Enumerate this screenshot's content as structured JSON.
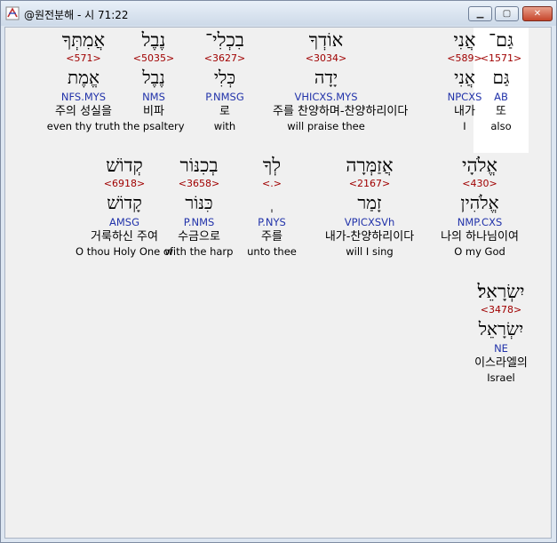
{
  "window": {
    "title": "@원전분해 - 시 71:22"
  },
  "controls": {
    "minimize": "▁",
    "maximize": "▢",
    "close": "✕"
  },
  "rows": [
    [
      {
        "heb": "גַּם־",
        "strong": "<1571>",
        "lemma": "גַּם",
        "morph": "AB",
        "kor": "또",
        "eng": "also",
        "selected": true
      },
      {
        "heb": "אֲנִי",
        "strong": "<589>",
        "lemma": "אֲנִי",
        "morph": "NPCXS",
        "kor": "내가",
        "eng": "I"
      },
      {
        "heb": "אוֹדְךָ",
        "strong": "<3034>",
        "lemma": "יָדָה",
        "morph": "VHICXS.MYS",
        "kor": "주를 찬양하며-찬양하리이다",
        "eng": "will praise thee"
      },
      {
        "heb": "בִכְלִי־",
        "strong": "<3627>",
        "lemma": "כְּלִי",
        "morph": "P.NMSG",
        "kor": "로",
        "eng": "with"
      },
      {
        "heb": "נֶבֶל",
        "strong": "<5035>",
        "lemma": "נֶבֶל",
        "morph": "NMS",
        "kor": "비파",
        "eng": "the psaltery"
      },
      {
        "heb": "אֲמִתְּךָ",
        "strong": "<571>",
        "lemma": "אֱמֶת",
        "morph": "NFS.MYS",
        "kor": "주의 성실을",
        "eng": "even thy truth"
      }
    ],
    [
      {
        "heb": "אֱלֹהָי",
        "strong": "<430>",
        "lemma": "אֱלֹהִין",
        "morph": "NMP.CXS",
        "kor": "나의 하나님이여",
        "eng": "O my God"
      },
      {
        "heb": "אֲזַמְּרָה",
        "strong": "<2167>",
        "lemma": "זָמַר",
        "morph": "VPICXSVh",
        "kor": "내가-찬양하리이다",
        "eng": "will I sing"
      },
      {
        "heb": "לְךָ",
        "strong": "<.>",
        "lemma": "ְ",
        "morph": "P.NYS",
        "kor": "주를",
        "eng": "unto thee"
      },
      {
        "heb": "בְכִנּוֹר",
        "strong": "<3658>",
        "lemma": "כִּנּוֹר",
        "morph": "P.NMS",
        "kor": "수금으로",
        "eng": "with the harp"
      },
      {
        "heb": "קְדוֹשׁ",
        "strong": "<6918>",
        "lemma": "קָדוֹשׁ",
        "morph": "AMSG",
        "kor": "거룩하신 주여",
        "eng": "O thou Holy One of"
      }
    ],
    [
      {
        "heb": "יִשְׂרָאֵל׃",
        "strong": "<3478>",
        "lemma": "יִשְׂרָאֵל",
        "morph": "NE",
        "kor": "이스라엘의",
        "eng": "Israel"
      }
    ]
  ]
}
